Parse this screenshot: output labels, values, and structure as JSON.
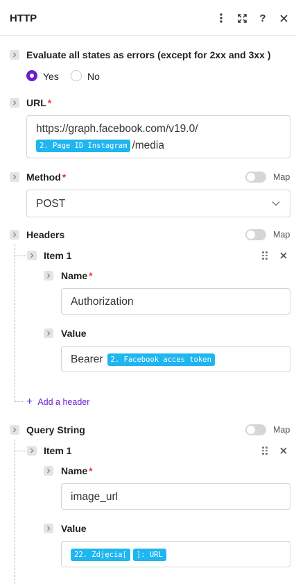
{
  "header": {
    "title": "HTTP"
  },
  "error_states": {
    "label": "Evaluate all states as errors (except for 2xx and 3xx )",
    "options": [
      "Yes",
      "No"
    ],
    "selected": "Yes"
  },
  "url": {
    "label": "URL",
    "line1": "https://graph.facebook.com/v19.0/",
    "pill": "2. Page ID Instagram",
    "suffix": "/media"
  },
  "method": {
    "label": "Method",
    "value": "POST",
    "map_label": "Map"
  },
  "headers": {
    "label": "Headers",
    "map_label": "Map",
    "item": {
      "label": "Item 1",
      "name_label": "Name",
      "name_value": "Authorization",
      "value_label": "Value",
      "value_text": "Bearer",
      "value_pill": "2. Facebook acces token"
    },
    "add_label": "Add a header"
  },
  "query": {
    "label": "Query String",
    "map_label": "Map",
    "item": {
      "label": "Item 1",
      "name_label": "Name",
      "name_value": "image_url",
      "value_label": "Value",
      "value_pill1": "22. Zdjęcia[",
      "value_pill2": "]: URL"
    }
  }
}
